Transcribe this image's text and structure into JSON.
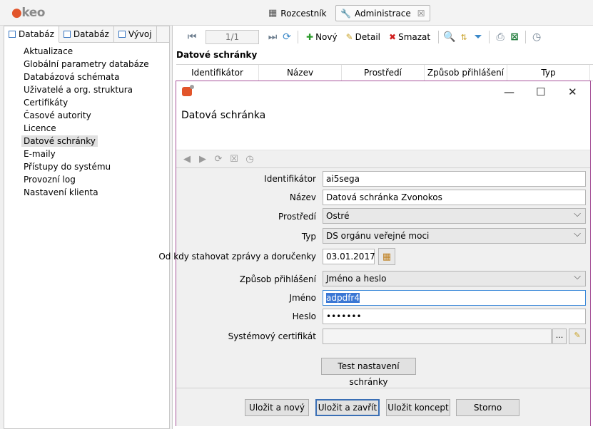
{
  "app": {
    "logo": "keo"
  },
  "top_tabs": [
    {
      "label": "Rozcestník"
    },
    {
      "label": "Administrace",
      "close": "☒"
    }
  ],
  "left_tabs": [
    {
      "label": "Databáz"
    },
    {
      "label": "Databáz"
    },
    {
      "label": "Vývoj"
    }
  ],
  "nav": {
    "items": [
      "Aktualizace",
      "Globální parametry databáze",
      "Databázová schémata",
      "Uživatelé a org. struktura",
      "Certifikáty",
      "Časové autority",
      "Licence",
      "Datové schránky",
      "E-maily",
      "Přístupy do systému",
      "Provozní log",
      "Nastavení klienta"
    ],
    "selected": "Datové schránky"
  },
  "toolbar": {
    "pager": "1/1",
    "new_label": "Nový",
    "detail_label": "Detail",
    "delete_label": "Smazat"
  },
  "list": {
    "title": "Datové schránky",
    "columns": [
      "Identifikátor",
      "Název",
      "Prostředí",
      "Způsob přihlášení",
      "Typ"
    ]
  },
  "dialog": {
    "heading": "Datová schránka",
    "fields": {
      "identifikator": {
        "label": "Identifikátor",
        "value": "ai5sega"
      },
      "nazev": {
        "label": "Název",
        "value": "Datová schránka Zvonokos"
      },
      "prostredi": {
        "label": "Prostředí",
        "value": "Ostré"
      },
      "typ": {
        "label": "Typ",
        "value": "DS orgánu veřejné moci"
      },
      "od_kdy": {
        "label": "Od kdy stahovat zprávy a doručenky",
        "value": "03.01.2017"
      },
      "zpusob": {
        "label": "Způsob přihlášení",
        "value": "Jméno a heslo"
      },
      "jmeno": {
        "label": "Jméno",
        "value": "adpdfr4"
      },
      "heslo": {
        "label": "Heslo",
        "value": "•••••••"
      },
      "certifikat": {
        "label": "Systémový certifikát",
        "value": "",
        "browse": "..."
      }
    },
    "test_button": "Test nastavení schránky",
    "buttons": {
      "save_new": "Uložit a nový",
      "save_close": "Uložit a zavřít",
      "save_draft": "Uložit koncept",
      "cancel": "Storno"
    }
  }
}
